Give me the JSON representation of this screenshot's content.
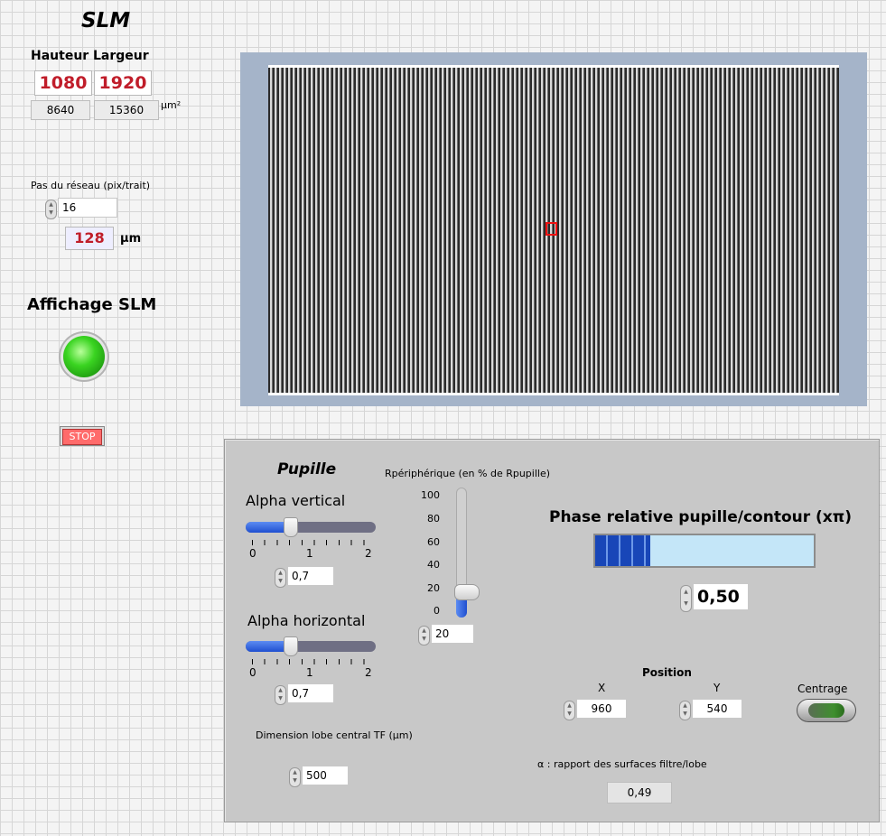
{
  "header": {
    "title": "SLM"
  },
  "dimensions": {
    "hauteur_label": "Hauteur",
    "largeur_label": "Largeur",
    "hauteur_px": "1080",
    "largeur_px": "1920",
    "hauteur_um": "8640",
    "largeur_um": "15360",
    "unit": "µm²"
  },
  "grating": {
    "label": "Pas du réseau (pix/trait)",
    "value": "16",
    "size_um": "128",
    "unit": "µm"
  },
  "display": {
    "label": "Affichage SLM",
    "led_on": true,
    "led_color": "#35d11f"
  },
  "stop": {
    "label": "STOP"
  },
  "pupille": {
    "title": "Pupille",
    "alpha_vertical": {
      "label": "Alpha vertical",
      "value": "0,7",
      "fraction": 0.35,
      "ticks": [
        "0",
        "1",
        "2"
      ]
    },
    "alpha_horizontal": {
      "label": "Alpha horizontal",
      "value": "0,7",
      "fraction": 0.35,
      "ticks": [
        "0",
        "1",
        "2"
      ]
    },
    "dimension_lobe": {
      "label": "Dimension lobe central TF (µm)",
      "value": "500"
    }
  },
  "rperipherique": {
    "label": "Rpériphérique (en % de Rpupille)",
    "scale": [
      "100",
      "80",
      "60",
      "40",
      "20",
      "0"
    ],
    "value": "20",
    "fraction": 0.2
  },
  "phase": {
    "label": "Phase relative pupille/contour (xπ)",
    "value": "0,50",
    "fraction": 0.25
  },
  "position": {
    "label": "Position",
    "x_label": "X",
    "x_value": "960",
    "y_label": "Y",
    "y_value": "540"
  },
  "centrage": {
    "label": "Centrage"
  },
  "alpha_ratio": {
    "label": "α : rapport des surfaces filtre/lobe",
    "value": "0,49"
  },
  "colors": {
    "accent_red": "#c01d2a",
    "slider_blue": "#2f61dd",
    "panel": "#c8c8c8"
  }
}
